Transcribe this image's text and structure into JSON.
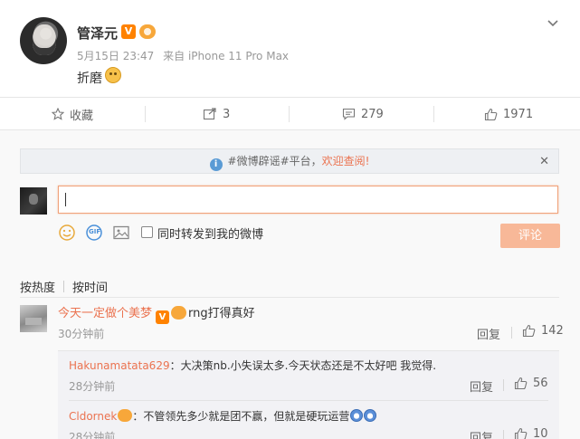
{
  "post": {
    "author": "管泽元",
    "verified_badge": "V",
    "time": "5月15日 23:47",
    "source": "来自 iPhone 11 Pro Max",
    "text": "折磨"
  },
  "actions": {
    "favorite": "收藏",
    "repost": "3",
    "comment": "279",
    "like": "1971"
  },
  "comment_panel": {
    "notice_prefix": "#微博辟谣#平台，",
    "notice_link": "欢迎查阅!",
    "input_value": "",
    "gif_label": "GIF",
    "also_repost_label": "同时转发到我的微博",
    "submit_label": "评论",
    "sort_hot": "按热度",
    "sort_time": "按时间"
  },
  "comments": [
    {
      "user": "今天一定做个美梦",
      "badge": "V",
      "text": "rng打得真好",
      "time": "30分钟前",
      "reply": "回复",
      "likes": "142"
    }
  ],
  "subcomments": [
    {
      "user": "Hakunamatata629",
      "text": "：大决策nb.小失误太多.今天状态还是不太好吧 我觉得.",
      "time": "28分钟前",
      "reply": "回复",
      "likes": "56"
    },
    {
      "user": "Cldornek",
      "text": "：不管领先多少就是团不赢，但就是硬玩运营",
      "time": "28分钟前",
      "reply": "回复",
      "likes": "10"
    }
  ],
  "colors": {
    "accent": "#eb7350",
    "badge": "#ff8200",
    "submit": "#f8b898"
  }
}
